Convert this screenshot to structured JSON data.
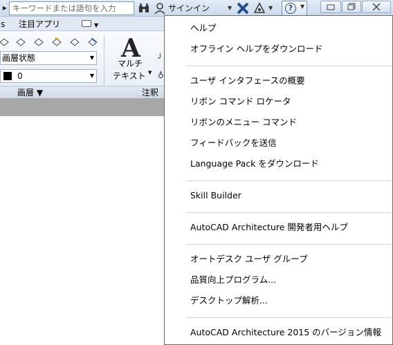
{
  "infobar": {
    "search_placeholder": "キーワードまたは語句を入力",
    "signin_label": "サインイン"
  },
  "ribbon": {
    "tabs": [
      {
        "label": "s"
      },
      {
        "label": "注目アプリ"
      }
    ],
    "layer_state_value": "画層状態",
    "layer_value": "0",
    "multitext_line1": "マルチ",
    "multitext_line2": "テキスト",
    "group_layers_label": "画層 ▼",
    "group_annotation_label": "注釈"
  },
  "help_menu": {
    "items": [
      {
        "label": "ヘルプ"
      },
      {
        "label": "オフライン ヘルプをダウンロード"
      },
      {
        "label": "ユーザ インタフェースの概要"
      },
      {
        "label": "リボン コマンド ロケータ"
      },
      {
        "label": "リボンのメニュー コマンド"
      },
      {
        "label": "フィードバックを送信"
      },
      {
        "label": "Language Pack をダウンロード"
      },
      {
        "label": "Skill Builder"
      },
      {
        "label": "AutoCAD Architecture 開発者用ヘルプ"
      },
      {
        "label": "オートデスク ユーザ グループ"
      },
      {
        "label": "品質向上プログラム..."
      },
      {
        "label": "デスクトップ解析..."
      },
      {
        "label": "AutoCAD Architecture 2015 のバージョン情報"
      }
    ]
  },
  "icons": {
    "search": "binoculars-icon",
    "user": "user-icon",
    "exchange": "x-exchange-icon",
    "a360": "a360-triangle-icon",
    "help": "help-circle-icon"
  },
  "colors": {
    "infobar_bg": "#d6e2f1",
    "menu_border": "#6b6b6b",
    "graybar": "#a8a8a8",
    "exchange_x": "#1f4e8c"
  }
}
